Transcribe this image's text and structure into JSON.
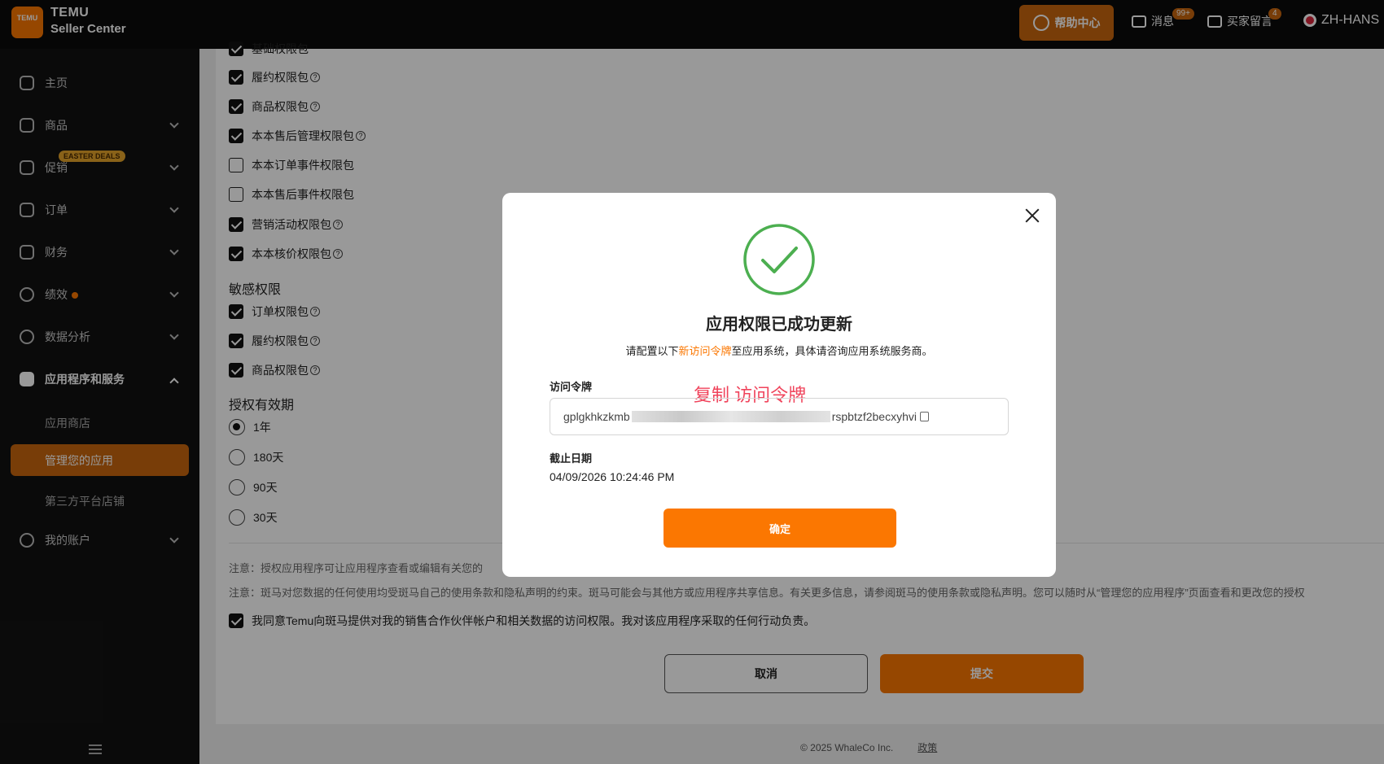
{
  "header": {
    "logo_text": "TEMU",
    "brand_line1": "TEMU",
    "brand_line2": "Seller Center",
    "help_label": "帮助中心",
    "messages_label": "消息",
    "messages_badge": "99+",
    "buyer_msg_label": "买家留言",
    "buyer_msg_badge": "4",
    "language": "ZH-HANS"
  },
  "sidebar": {
    "items": [
      {
        "label": "主页"
      },
      {
        "label": "商品"
      },
      {
        "label": "促销",
        "badge": "EASTER DEALS"
      },
      {
        "label": "订单"
      },
      {
        "label": "财务"
      },
      {
        "label": "绩效"
      },
      {
        "label": "数据分析"
      },
      {
        "label": "应用程序和服务"
      },
      {
        "label": "我的账户"
      }
    ],
    "sub_items": [
      "应用商店",
      "管理您的应用",
      "第三方平台店铺"
    ]
  },
  "permissions": {
    "partial_top": "基础权限包",
    "basic": [
      {
        "label": "履约权限包",
        "checked": true
      },
      {
        "label": "商品权限包",
        "checked": true
      },
      {
        "label": "本本售后管理权限包",
        "checked": true
      },
      {
        "label": "本本订单事件权限包",
        "checked": false
      },
      {
        "label": "本本售后事件权限包",
        "checked": false
      },
      {
        "label": "营销活动权限包",
        "checked": true
      },
      {
        "label": "本本核价权限包",
        "checked": true
      }
    ],
    "sensitive_title": "敏感权限",
    "sensitive": [
      {
        "label": "订单权限包",
        "checked": true
      },
      {
        "label": "履约权限包",
        "checked": true
      },
      {
        "label": "商品权限包",
        "checked": true
      }
    ],
    "validity_title": "授权有效期",
    "validity_options": [
      {
        "label": "1年",
        "selected": true
      },
      {
        "label": "180天",
        "selected": false
      },
      {
        "label": "90天",
        "selected": false
      },
      {
        "label": "30天",
        "selected": false
      }
    ]
  },
  "notes": {
    "note1": "注意：授权应用程序可让应用程序查看或编辑有关您的",
    "note2": "注意：斑马对您数据的任何使用均受斑马自己的使用条款和隐私声明的约束。斑马可能会与其他方或应用程序共享信息。有关更多信息，请参阅斑马的使用条款或隐私声明。您可以随时从“管理您的应用程序”页面查看和更改您的授权",
    "agree": "我同意Temu向斑马提供对我的销售合作伙伴帐户和相关数据的访问权限。我对该应用程序采取的任何行动负责。"
  },
  "buttons": {
    "cancel": "取消",
    "submit": "提交"
  },
  "footer": {
    "copyright": "© 2025 WhaleCo Inc.",
    "policy": "政策"
  },
  "modal": {
    "title": "应用权限已成功更新",
    "desc_prefix": "请配置以下",
    "desc_highlight": "新访问令牌",
    "desc_suffix": "至应用系统，具体请咨询应用系统服务商。",
    "token_label": "访问令牌",
    "copy_hint": "复制 访问令牌",
    "token_start": "gplgkhkzkmb",
    "token_end": "rspbtzf2becxyhvi",
    "expiry_label": "截止日期",
    "expiry_value": "04/09/2026 10:24:46 PM",
    "ok": "确定"
  },
  "colors": {
    "accent": "#fb7701",
    "accent_dark": "#c9660e",
    "success": "#4caf50",
    "copy_hint": "#f0435b"
  }
}
